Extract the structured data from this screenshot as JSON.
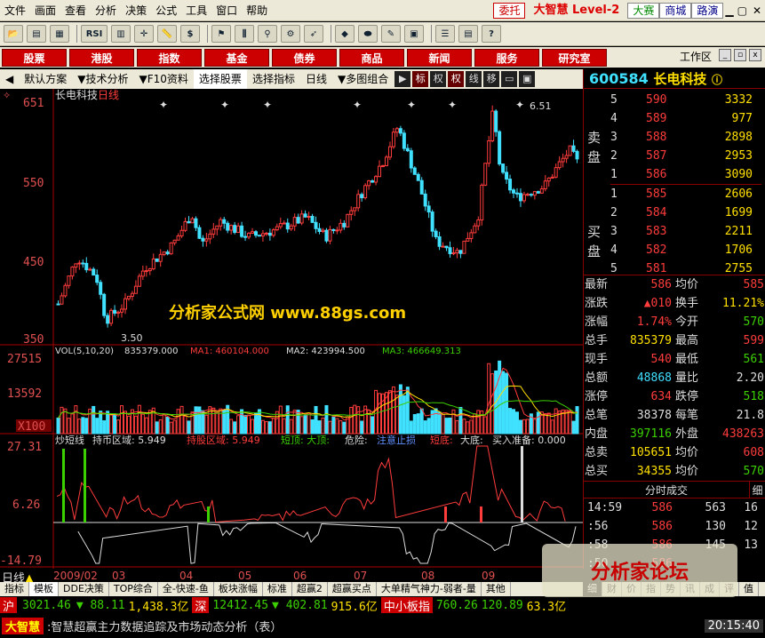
{
  "menu": [
    "文件",
    "画面",
    "查看",
    "分析",
    "决策",
    "公式",
    "工具",
    "窗口",
    "帮助"
  ],
  "menu_right": {
    "entrust": "委托",
    "brand": "大智慧 Level-2",
    "contest": "大赛",
    "mall": "商城",
    "roadshow": "路演"
  },
  "toolbar_icons": [
    "open-icon",
    "chart-icon",
    "grid-icon",
    "rsi-icon",
    "spreadsheet-icon",
    "crosshair-icon",
    "ruler-icon",
    "dollar-icon",
    "flag-icon",
    "bars-icon",
    "binoculars-icon",
    "gear-icon",
    "rocket-icon",
    "diamond-icon",
    "pill-icon",
    "pencil-icon",
    "book-icon",
    "notes-icon",
    "stack-icon",
    "help-icon"
  ],
  "navbuttons": [
    "股票",
    "港股",
    "指数",
    "基金",
    "债券",
    "商品",
    "新闻",
    "服务",
    "研究室"
  ],
  "workzone": "工作区",
  "subbar": {
    "items": [
      "默认方案",
      "技术分析",
      "F10资料",
      "选择股票",
      "选择指标",
      "日线",
      "多图组合"
    ],
    "icons": [
      "标",
      "权",
      "权",
      "线",
      "移"
    ]
  },
  "chart": {
    "title": "长电科技",
    "period": "日线",
    "ytop": "651",
    "y550": "550",
    "y450": "450",
    "ybot": "350",
    "high_label": "6.51",
    "low_label": "3.50",
    "watermark": "分析家公式网 www.88gs.com"
  },
  "vol": {
    "label": "VOL(5,10,20)",
    "value": "835379.000",
    "ma1": "MA1: 460104.000",
    "ma2": "MA2: 423994.500",
    "ma3": "MA3: 466649.313",
    "ytop": "27515",
    "ymid": "13592",
    "ybot": "X100"
  },
  "ind": {
    "name": "炒短线",
    "hold": "持币区域: 5.949",
    "shares": "持股区域: 5.949",
    "short_top": "短顶: 大顶:",
    "danger": "危险:",
    "notice": "注意止损",
    "short_bottom": "短底:",
    "big_bottom": "大底:",
    "buy": "买入准备: 0.000",
    "ytop": "27.31",
    "ymid": "6.26",
    "ybot": "-14.79"
  },
  "xaxis": [
    "2009/02",
    "03",
    "04",
    "05",
    "06",
    "07",
    "08",
    "09"
  ],
  "quote": {
    "code": "600584",
    "name": "长电科技",
    "sell_label": [
      "卖",
      "盘"
    ],
    "buy_label": [
      "买",
      "盘"
    ],
    "sells": [
      {
        "lvl": "5",
        "price": "590",
        "vol": "3332"
      },
      {
        "lvl": "4",
        "price": "589",
        "vol": "977"
      },
      {
        "lvl": "3",
        "price": "588",
        "vol": "2898"
      },
      {
        "lvl": "2",
        "price": "587",
        "vol": "2953"
      },
      {
        "lvl": "1",
        "price": "586",
        "vol": "3090"
      }
    ],
    "buys": [
      {
        "lvl": "1",
        "price": "585",
        "vol": "2606"
      },
      {
        "lvl": "2",
        "price": "584",
        "vol": "1699"
      },
      {
        "lvl": "3",
        "price": "583",
        "vol": "2211"
      },
      {
        "lvl": "4",
        "price": "582",
        "vol": "1706"
      },
      {
        "lvl": "5",
        "price": "581",
        "vol": "2755"
      }
    ],
    "stats": [
      {
        "k1": "最新",
        "v1": "586",
        "k2": "均价",
        "v2": "585"
      },
      {
        "k1": "涨跌",
        "v1": "▲010",
        "k2": "换手",
        "v2": "11.21%"
      },
      {
        "k1": "涨幅",
        "v1": "1.74%",
        "k2": "今开",
        "v2": "570"
      },
      {
        "k1": "总手",
        "v1": "835379",
        "k2": "最高",
        "v2": "599"
      },
      {
        "k1": "现手",
        "v1": "540",
        "k2": "最低",
        "v2": "561"
      },
      {
        "k1": "总额",
        "v1": "48868",
        "k2": "量比",
        "v2": "2.20"
      },
      {
        "k1": "涨停",
        "v1": "634",
        "k2": "跌停",
        "v2": "518"
      },
      {
        "k1": "总笔",
        "v1": "38378",
        "k2": "每笔",
        "v2": "21.8"
      },
      {
        "k1": "内盘",
        "v1": "397116",
        "k2": "外盘",
        "v2": "438263"
      },
      {
        "k1": "总卖",
        "v1": "105651",
        "k2": "均价",
        "v2": "608"
      },
      {
        "k1": "总买",
        "v1": "34355",
        "k2": "均价",
        "v2": "570"
      }
    ],
    "ticks_title": "分时成交",
    "ticks_tab": "细",
    "ticks": [
      {
        "t": "14:59",
        "p": "586",
        "q": "563",
        "n": "16"
      },
      {
        "t": ":56",
        "p": "586",
        "q": "130",
        "n": "12"
      },
      {
        "t": ":58",
        "p": "586",
        "q": "145",
        "n": "13"
      },
      {
        "t": ":50",
        "p": "586",
        "q": "",
        "n": ""
      }
    ]
  },
  "footer": {
    "period_label": "日线",
    "tabs": [
      "指标",
      "模板",
      "DDE决策",
      "TOP综合",
      "全-快速-鱼",
      "板块涨幅",
      "标准",
      "超赢2",
      "超赢买点",
      "大单精气神力-弱者-量",
      "其他"
    ],
    "side_tabs": [
      "细",
      "财",
      "价",
      "指",
      "势",
      "讯",
      "成",
      "评",
      "值"
    ],
    "sh_label": "沪",
    "sh_val": "3021.46",
    "sh_chg": "▼ 88.11",
    "sh_amt": "1,438.3亿",
    "sz_label": "深",
    "sz_val": "12412.45",
    "sz_chg": "▼ 402.81",
    "sz_amt": "915.6亿",
    "sme_label": "中小板指",
    "sme_val": "760.26",
    "sme_chg": "120.89",
    "sme_amt": "63.3亿",
    "brand": "大智慧",
    "marquee": ":智慧超赢主力数据追踪及市场动态分析（表）",
    "site": "分析家论坛",
    "time": "20:15:40"
  },
  "colors": {
    "up": "#ff3c3c",
    "down": "#40e0ff",
    "bg": "#000000",
    "grid": "#800000"
  }
}
